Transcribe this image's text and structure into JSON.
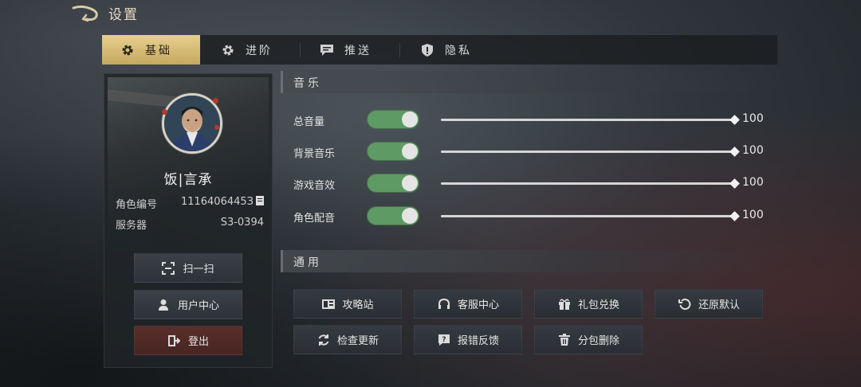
{
  "header": {
    "title": "设置"
  },
  "tabs": [
    {
      "label": "基础",
      "icon": "gear-icon",
      "active": true
    },
    {
      "label": "进阶",
      "icon": "gear-icon",
      "active": false
    },
    {
      "label": "推送",
      "icon": "message-icon",
      "active": false
    },
    {
      "label": "隐私",
      "icon": "shield-icon",
      "active": false
    }
  ],
  "profile": {
    "name": "饭|言承",
    "role_id_label": "角色编号",
    "role_id": "1116406445З",
    "server_label": "服务器",
    "server": "S3-0394",
    "buttons": [
      {
        "label": "扫一扫",
        "icon": "scan-icon"
      },
      {
        "label": "用户中心",
        "icon": "user-icon"
      },
      {
        "label": "登出",
        "icon": "logout-icon"
      }
    ]
  },
  "music": {
    "title": "音乐",
    "rows": [
      {
        "label": "总音量",
        "enabled": true,
        "value": "100",
        "level": 100
      },
      {
        "label": "背景音乐",
        "enabled": true,
        "value": "100",
        "level": 100
      },
      {
        "label": "游戏音效",
        "enabled": true,
        "value": "100",
        "level": 100
      },
      {
        "label": "角色配音",
        "enabled": true,
        "value": "100",
        "level": 100
      }
    ]
  },
  "general": {
    "title": "通用",
    "buttons": [
      {
        "label": "攻略站",
        "icon": "book-icon"
      },
      {
        "label": "客服中心",
        "icon": "headset-icon"
      },
      {
        "label": "礼包兑换",
        "icon": "gift-icon"
      },
      {
        "label": "还原默认",
        "icon": "reset-icon"
      },
      {
        "label": "检查更新",
        "icon": "refresh-icon"
      },
      {
        "label": "报错反馈",
        "icon": "feedback-icon"
      },
      {
        "label": "分包删除",
        "icon": "trash-icon"
      }
    ]
  },
  "colors": {
    "accent_gold": "#d9bd78",
    "toggle_on": "#5e9a63",
    "logout": "#4f2a27"
  }
}
